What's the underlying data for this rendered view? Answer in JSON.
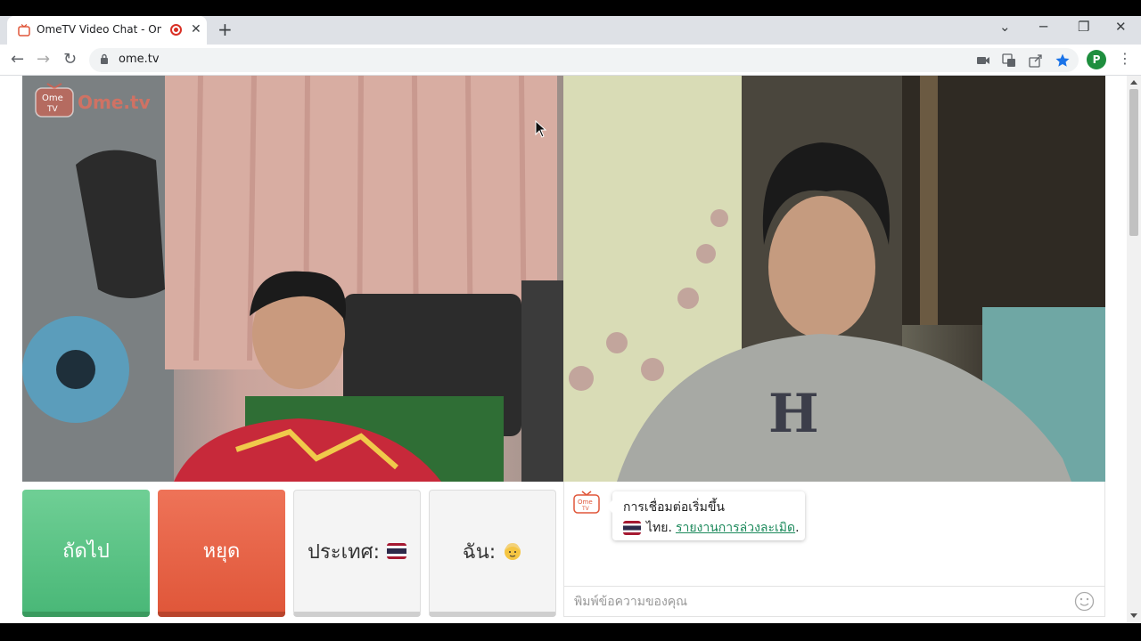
{
  "browser": {
    "tab_title": "OmeTV Video Chat - Omegl",
    "url": "ome.tv",
    "avatar_letter": "P"
  },
  "logo": {
    "text": "Ome.tv",
    "badge_top": "Ome",
    "badge_bottom": "TV"
  },
  "controls": {
    "next_label": "ถัดไป",
    "stop_label": "หยุด",
    "country_label": "ประเทศ:",
    "me_label": "ฉัน:"
  },
  "chat": {
    "line1": "การเชื่อมต่อเริ่มขึ้น",
    "country_text": "ไทย.",
    "report_link": "รายงานการล่วงละเมิด",
    "report_suffix": ".",
    "input_placeholder": "พิมพ์ข้อความของคุณ"
  },
  "colors": {
    "next": "#4ab878",
    "stop": "#e0573a",
    "link": "#1d8a5c"
  }
}
